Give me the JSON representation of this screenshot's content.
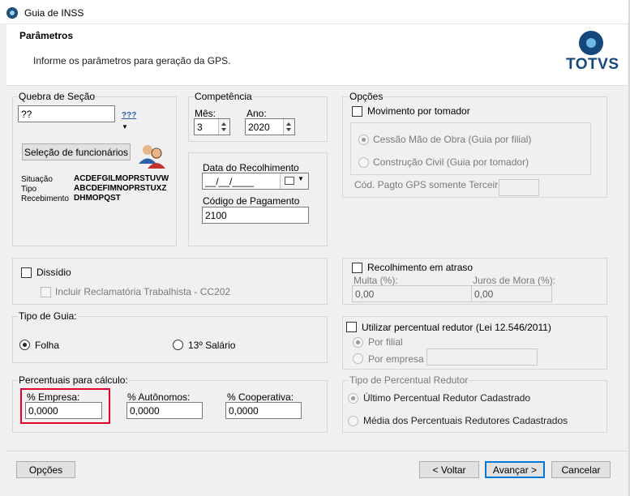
{
  "window": {
    "title": "Guia de INSS"
  },
  "header": {
    "title": "Parâmetros",
    "subtitle": "Informe os parâmetros para geração da GPS.",
    "logo_text": "TOTVS"
  },
  "quebra": {
    "label": "Quebra de Seção",
    "value": "??",
    "icon_text": "???",
    "selecao_button": "Seleção de funcionários",
    "situacao_label": "Situação",
    "situacao_value": "ACDEFGILMOPRSTUVW",
    "tipo_label": "Tipo",
    "tipo_value": "ABCDEFIMNOPRSTUXZ",
    "recebimento_label": "Recebimento",
    "recebimento_value": "DHMOPQST"
  },
  "competencia": {
    "label": "Competência",
    "mes_label": "Mês:",
    "mes_value": "3",
    "ano_label": "Ano:",
    "ano_value": "2020"
  },
  "recolhimento": {
    "data_label": "Data do Recolhimento",
    "data_value": "__/__/____",
    "codigo_label": "Código de Pagamento",
    "codigo_value": "2100"
  },
  "opcoes": {
    "label": "Opções",
    "movimento_label": "Movimento por tomador",
    "cessao_label": "Cessão Mão de Obra (Guia por filial)",
    "construcao_label": "Construção Civil (Guia por tomador)",
    "cod_pagto_label": "Cód. Pagto GPS somente Terceiros:",
    "cod_pagto_value": ""
  },
  "dissidio": {
    "label": "Dissídio",
    "incluir_label": "Incluir Reclamatória Trabalhista - CC202"
  },
  "atraso": {
    "label": "Recolhimento em atraso",
    "multa_label": "Multa (%):",
    "multa_value": "0,00",
    "juros_label": "Juros de Mora (%):",
    "juros_value": "0,00"
  },
  "tipo_guia": {
    "label": "Tipo de Guia:",
    "folha_label": "Folha",
    "salario13_label": "13º Salário",
    "selected": "Folha"
  },
  "redutor": {
    "label": "Utilizar percentual redutor (Lei 12.546/2011)",
    "por_filial_label": "Por filial",
    "por_empresa_label": "Por empresa",
    "por_empresa_value": ""
  },
  "percentuais": {
    "label": "Percentuais para cálculo:",
    "empresa_label": "% Empresa:",
    "empresa_value": "0,0000",
    "autonomos_label": "% Autônomos:",
    "autonomos_value": "0,0000",
    "cooperativa_label": "% Cooperativa:",
    "cooperativa_value": "0,0000"
  },
  "tipo_redutor": {
    "label": "Tipo de Percentual Redutor",
    "ultimo_label": "Último Percentual Redutor Cadastrado",
    "media_label": "Média dos Percentuais Redutores Cadastrados"
  },
  "footer": {
    "opcoes_button": "Opções",
    "voltar_button": "< Voltar",
    "avancar_button": "Avançar >",
    "cancelar_button": "Cancelar"
  },
  "colors": {
    "highlight": "#e4002b",
    "brand": "#14477a",
    "default_button": "#0078d7"
  }
}
